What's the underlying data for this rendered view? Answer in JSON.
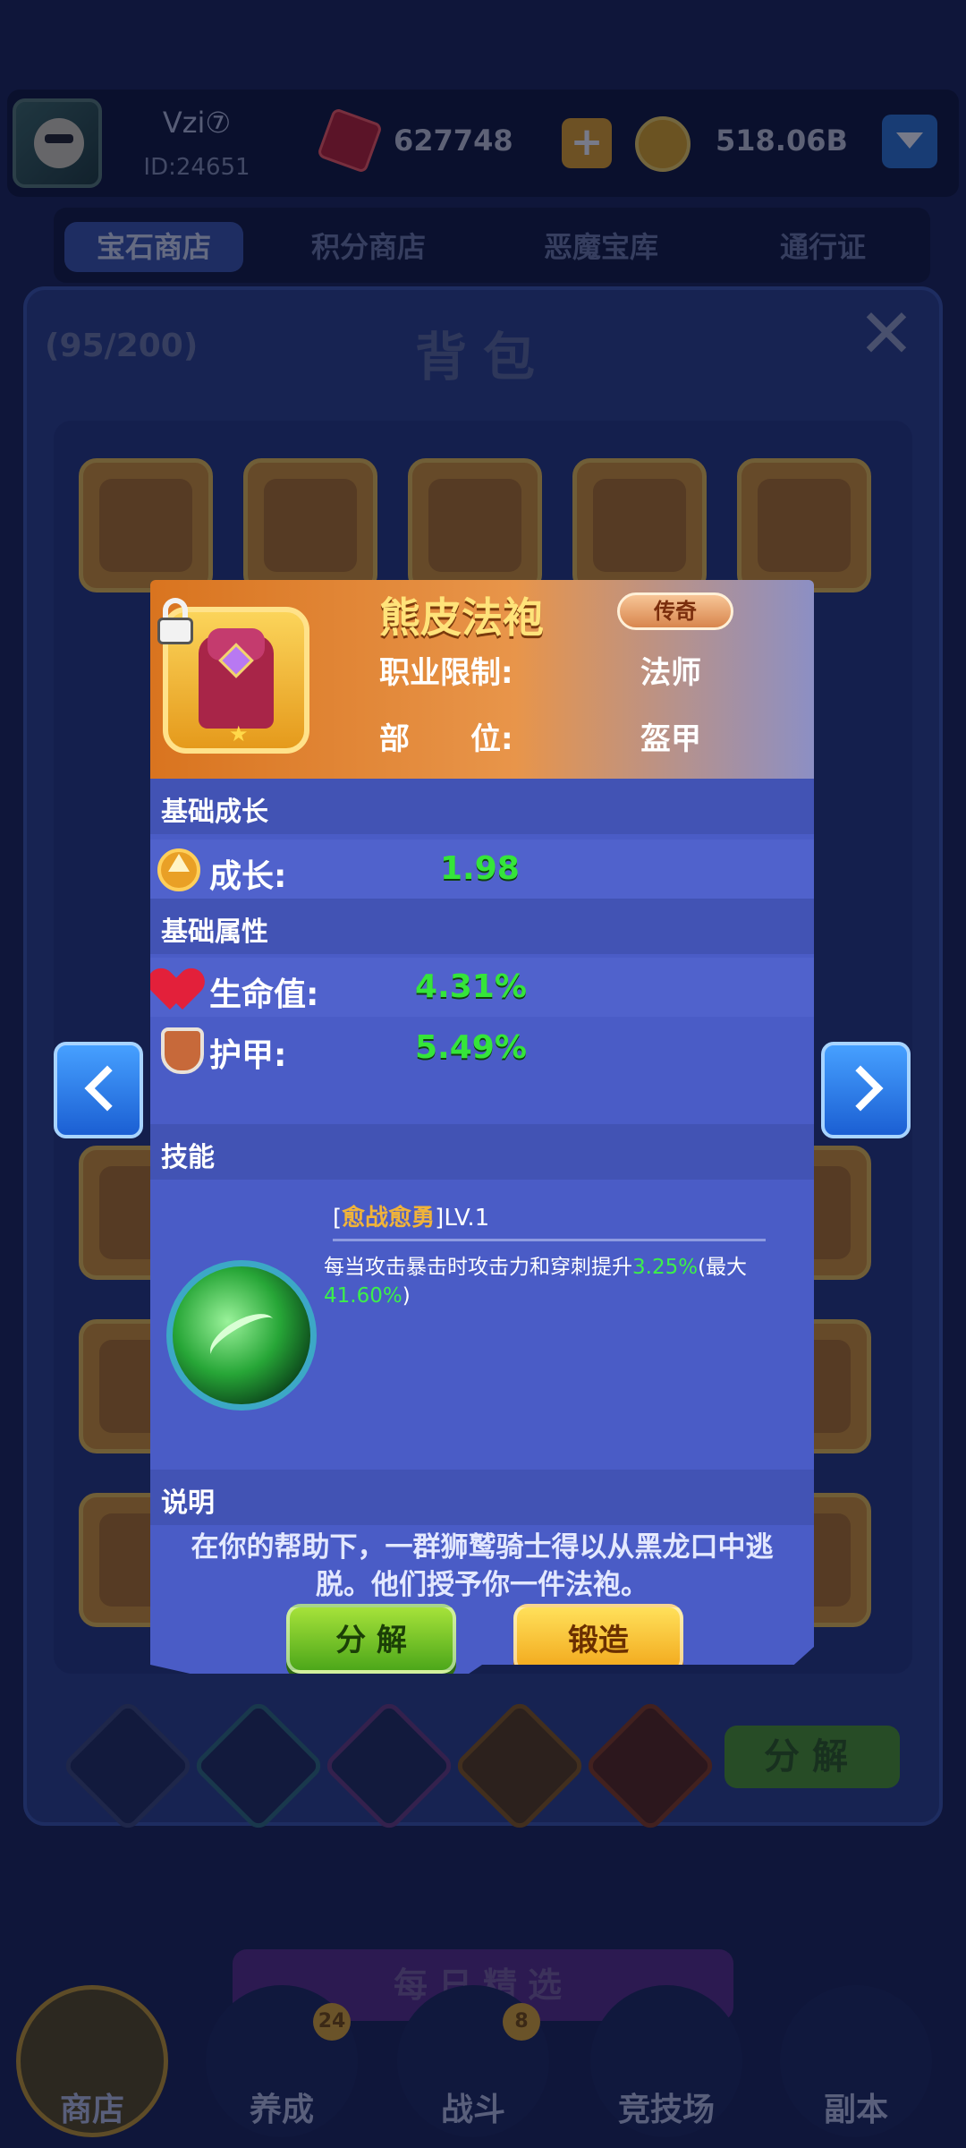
{
  "header": {
    "player_name": "Vzi⑦",
    "player_id": "ID:24651",
    "gems": "627748",
    "coins": "518.06B"
  },
  "shop_tabs": [
    {
      "label": "宝石商店",
      "active": true
    },
    {
      "label": "积分商店",
      "active": false
    },
    {
      "label": "恶魔宝库",
      "active": false
    },
    {
      "label": "通行证",
      "active": false
    }
  ],
  "backpack": {
    "count": "(95/200)",
    "title": "背包",
    "decompose_label": "分解"
  },
  "item": {
    "name": "熊皮法袍",
    "rarity": "传奇",
    "class_label": "职业限制:",
    "class_value": "法师",
    "slot_label": "部　　位:",
    "slot_value": "盔甲",
    "sections": {
      "growth": "基础成长",
      "attributes": "基础属性",
      "skills": "技能",
      "description": "说明"
    },
    "growth": {
      "label": "成长:",
      "value": "1.98"
    },
    "hp": {
      "label": "生命值:",
      "value": "4.31%"
    },
    "armor": {
      "label": "护甲:",
      "value": "5.49%"
    },
    "skill": {
      "name": "愈战愈勇",
      "level": "LV.1",
      "desc_prefix": "每当攻击暴击时攻击力和穿刺提升",
      "desc_value": "3.25%",
      "desc_mid": "(最大",
      "desc_max": "41.60%",
      "desc_suffix": ")"
    },
    "description": "在你的帮助下，一群狮鹫骑士得以从黑龙口中逃脱。他们授予你一件法袍。",
    "buttons": {
      "decompose": "分 解",
      "forge": "锻造"
    }
  },
  "daily_banner": "每日精选",
  "bottom_nav": [
    {
      "label": "商店",
      "active": true,
      "badge": ""
    },
    {
      "label": "养成",
      "active": false,
      "badge": "24"
    },
    {
      "label": "战斗",
      "active": false,
      "badge": "8"
    },
    {
      "label": "竞技场",
      "active": false,
      "badge": ""
    },
    {
      "label": "副本",
      "active": false,
      "badge": ""
    }
  ],
  "colors": {
    "stat_green": "#35e53a",
    "legend_orange": "#e8954a",
    "popup_blue": "#4a5cc6"
  }
}
